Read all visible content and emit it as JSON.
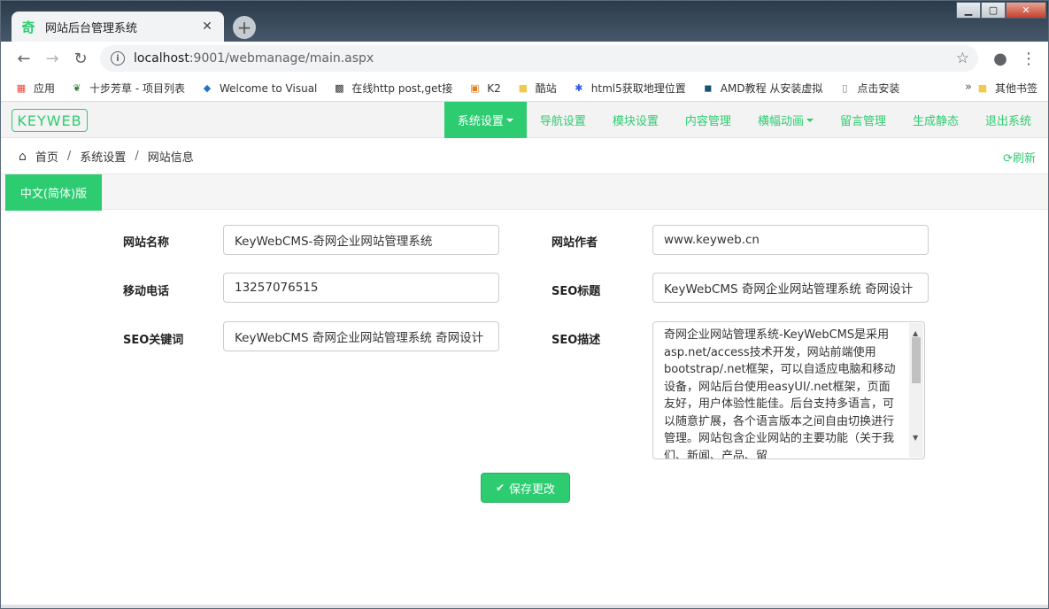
{
  "browser": {
    "tab_title": "网站后台管理系统",
    "tab_favicon": "奇",
    "url_host": "localhost",
    "url_rest": ":9001/webmanage/main.aspx",
    "bookmarks": [
      {
        "label": "应用",
        "icon": "apps-icon"
      },
      {
        "label": "十步芳草 - 项目列表",
        "icon": "leaf-icon"
      },
      {
        "label": "Welcome to Visual",
        "icon": "visualstudio-icon"
      },
      {
        "label": "在线http post,get接",
        "icon": "qrcode-icon"
      },
      {
        "label": "K2",
        "icon": "presentation-icon"
      },
      {
        "label": "酷站",
        "icon": "folder-icon"
      },
      {
        "label": "html5获取地理位置",
        "icon": "paw-icon"
      },
      {
        "label": "AMD教程 从安装虚拟",
        "icon": "amd-icon"
      },
      {
        "label": "点击安装",
        "icon": "page-icon"
      }
    ],
    "bookmarks_more": "»",
    "other_bookmarks": "其他书签"
  },
  "app": {
    "logo": "KEYWEB",
    "menu": [
      {
        "label": "系统设置",
        "dropdown": true,
        "active": true
      },
      {
        "label": "导航设置",
        "dropdown": false,
        "active": false
      },
      {
        "label": "模块设置",
        "dropdown": false,
        "active": false
      },
      {
        "label": "内容管理",
        "dropdown": false,
        "active": false
      },
      {
        "label": "横幅动画",
        "dropdown": true,
        "active": false
      },
      {
        "label": "留言管理",
        "dropdown": false,
        "active": false
      },
      {
        "label": "生成静态",
        "dropdown": false,
        "active": false
      },
      {
        "label": "退出系统",
        "dropdown": false,
        "active": false
      }
    ],
    "breadcrumb": [
      "首页",
      "系统设置",
      "网站信息"
    ],
    "breadcrumb_sep": "/",
    "refresh_label": "刷新",
    "lang_tab": "中文(简体)版",
    "accent": "#2ecc71"
  },
  "form": {
    "site_name_label": "网站名称",
    "site_name_value": "KeyWebCMS-奇网企业网站管理系统",
    "author_label": "网站作者",
    "author_value": "www.keyweb.cn",
    "mobile_label": "移动电话",
    "mobile_value": "13257076515",
    "seo_title_label": "SEO标题",
    "seo_title_value": "KeyWebCMS 奇网企业网站管理系统 奇网设计",
    "seo_keywords_label": "SEO关键词",
    "seo_keywords_value": "KeyWebCMS 奇网企业网站管理系统 奇网设计",
    "seo_desc_label": "SEO描述",
    "seo_desc_value": "奇网企业网站管理系统-KeyWebCMS是采用asp.net/access技术开发，网站前端使用bootstrap/.net框架，可以自适应电脑和移动设备，网站后台使用easyUI/.net框架，页面友好，用户体验性能佳。后台支持多语言，可以随意扩展，各个语言版本之间自由切换进行管理。网站包含企业网站的主要功能（关于我们、新闻、产品、留",
    "save_label": "保存更改"
  }
}
